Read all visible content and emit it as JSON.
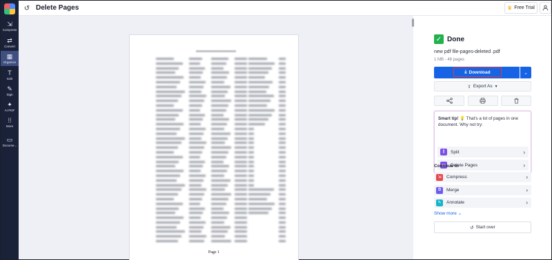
{
  "sidebar": {
    "items": [
      {
        "label": "Compress",
        "icon": "compress-icon",
        "glyph": "⇲"
      },
      {
        "label": "Convert",
        "icon": "convert-icon",
        "glyph": "⇄"
      },
      {
        "label": "Organize",
        "icon": "organize-icon",
        "glyph": "▦",
        "active": true
      },
      {
        "label": "Edit",
        "icon": "edit-icon",
        "glyph": "T"
      },
      {
        "label": "Sign",
        "icon": "sign-icon",
        "glyph": "✎"
      },
      {
        "label": "AI PDF",
        "icon": "ai-icon",
        "glyph": "✦"
      },
      {
        "label": "More",
        "icon": "more-icon",
        "glyph": "⁞⁞"
      },
      {
        "label": "Docume...",
        "icon": "folder-icon",
        "glyph": "▭"
      }
    ]
  },
  "header": {
    "title": "Delete Pages",
    "free_trial": "Free Trial"
  },
  "viewer": {
    "page_label": "Page 1"
  },
  "panel": {
    "status": "Done",
    "file_name": "new pdf file-pages-deleted .pdf",
    "file_meta": "1 MB - 48 pages",
    "download_label": "Download",
    "export_label": "Export As",
    "smart_tip_title": "Smart tip!",
    "smart_tip_text": "That's a lot of pages in one document. Why not try:",
    "smart_items": [
      "Split",
      "Delete Pages"
    ],
    "continue_label": "Continue in",
    "continue_items": [
      {
        "label": "Compress",
        "color": "#e5484d"
      },
      {
        "label": "Merge",
        "color": "#6b5cf0"
      },
      {
        "label": "Annotate",
        "color": "#17b3c9"
      }
    ],
    "show_more": "Show more",
    "start_over": "Start over"
  },
  "colors": {
    "sidebar_bg": "#1a2239",
    "accent": "#1663e6",
    "success": "#22b14c"
  }
}
